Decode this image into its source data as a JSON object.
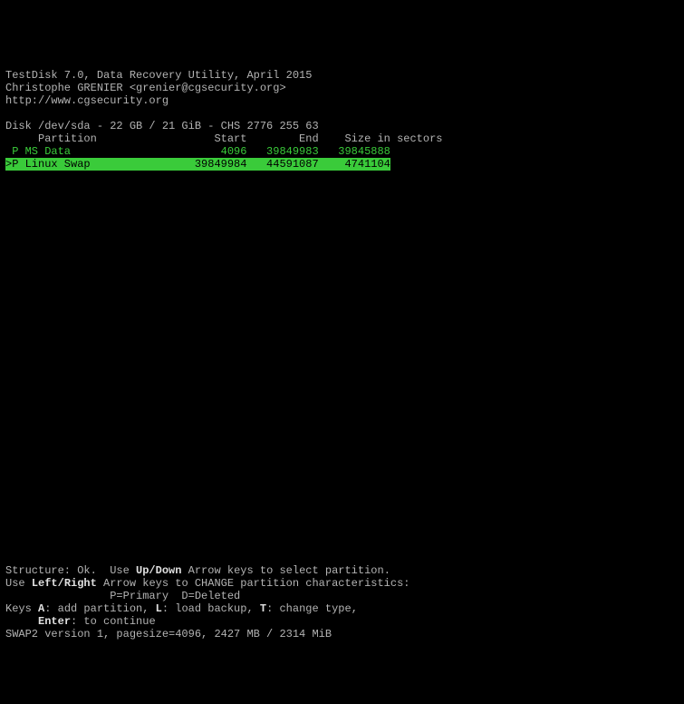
{
  "header": {
    "line1": "TestDisk 7.0, Data Recovery Utility, April 2015",
    "line2": "Christophe GRENIER <grenier@cgsecurity.org>",
    "line3": "http://www.cgsecurity.org"
  },
  "disk": {
    "line": "Disk /dev/sda - 22 GB / 21 GiB - CHS 2776 255 63"
  },
  "cols": {
    "header": "     Partition                  Start        End    Size in sectors"
  },
  "partitions": [
    {
      "line": " P MS Data                       4096   39849983   39845888",
      "selected": false
    },
    {
      "line": ">P Linux Swap                39849984   44591087    4741104",
      "selected": true
    }
  ],
  "footer": {
    "struct_prefix": "Structure: Ok.  Use ",
    "updown": "Up/Down",
    "struct_suffix": " Arrow keys to select partition.",
    "lr_prefix": "Use ",
    "leftright": "Left/Right",
    "lr_suffix": " Arrow keys to CHANGE partition characteristics:",
    "pd_line": "                P=Primary  D=Deleted",
    "keys_prefix": "Keys ",
    "key_a": "A",
    "key_a_suffix": ": add partition, ",
    "key_l": "L",
    "key_l_suffix": ": load backup, ",
    "key_t": "T",
    "key_t_suffix": ": change type,",
    "enter_prefix": "     ",
    "enter": "Enter",
    "enter_suffix": ": to continue",
    "swap_line": "SWAP2 version 1, pagesize=4096, 2427 MB / 2314 MiB"
  }
}
